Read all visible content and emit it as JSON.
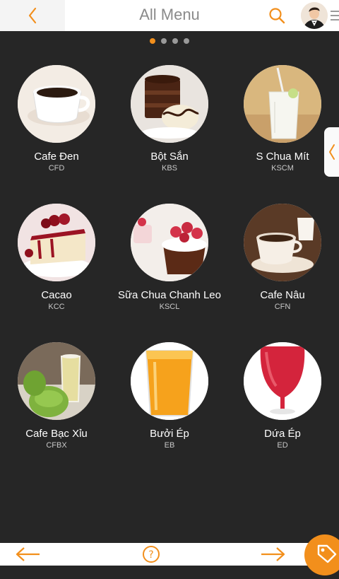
{
  "header": {
    "title": "All Menu",
    "back_icon": "chevron-left-icon",
    "search_icon": "search-icon",
    "menu_icon": "hamburger-icon"
  },
  "pager": {
    "pages": 4,
    "active": 1
  },
  "items": [
    {
      "name": "Cafe Đen",
      "code": "CFD"
    },
    {
      "name": "Bột Sắn",
      "code": "KBS"
    },
    {
      "name": "S Chua Mít",
      "code": "KSCM"
    },
    {
      "name": "Cacao",
      "code": "KCC"
    },
    {
      "name": "Sữa Chua Chanh Leo",
      "code": "KSCL"
    },
    {
      "name": "Cafe Nâu",
      "code": "CFN"
    },
    {
      "name": "Cafe Bạc Xỉu",
      "code": "CFBX"
    },
    {
      "name": "Bưởi Ép",
      "code": "EB"
    },
    {
      "name": "Dứa Ép",
      "code": "ED"
    }
  ],
  "footer": {
    "prev_icon": "arrow-left-icon",
    "help_icon": "question-circle-icon",
    "next_icon": "arrow-right-icon",
    "tag_icon": "tag-icon"
  },
  "colors": {
    "accent": "#f28f1c",
    "background": "#262626",
    "header": "#ffffff"
  }
}
